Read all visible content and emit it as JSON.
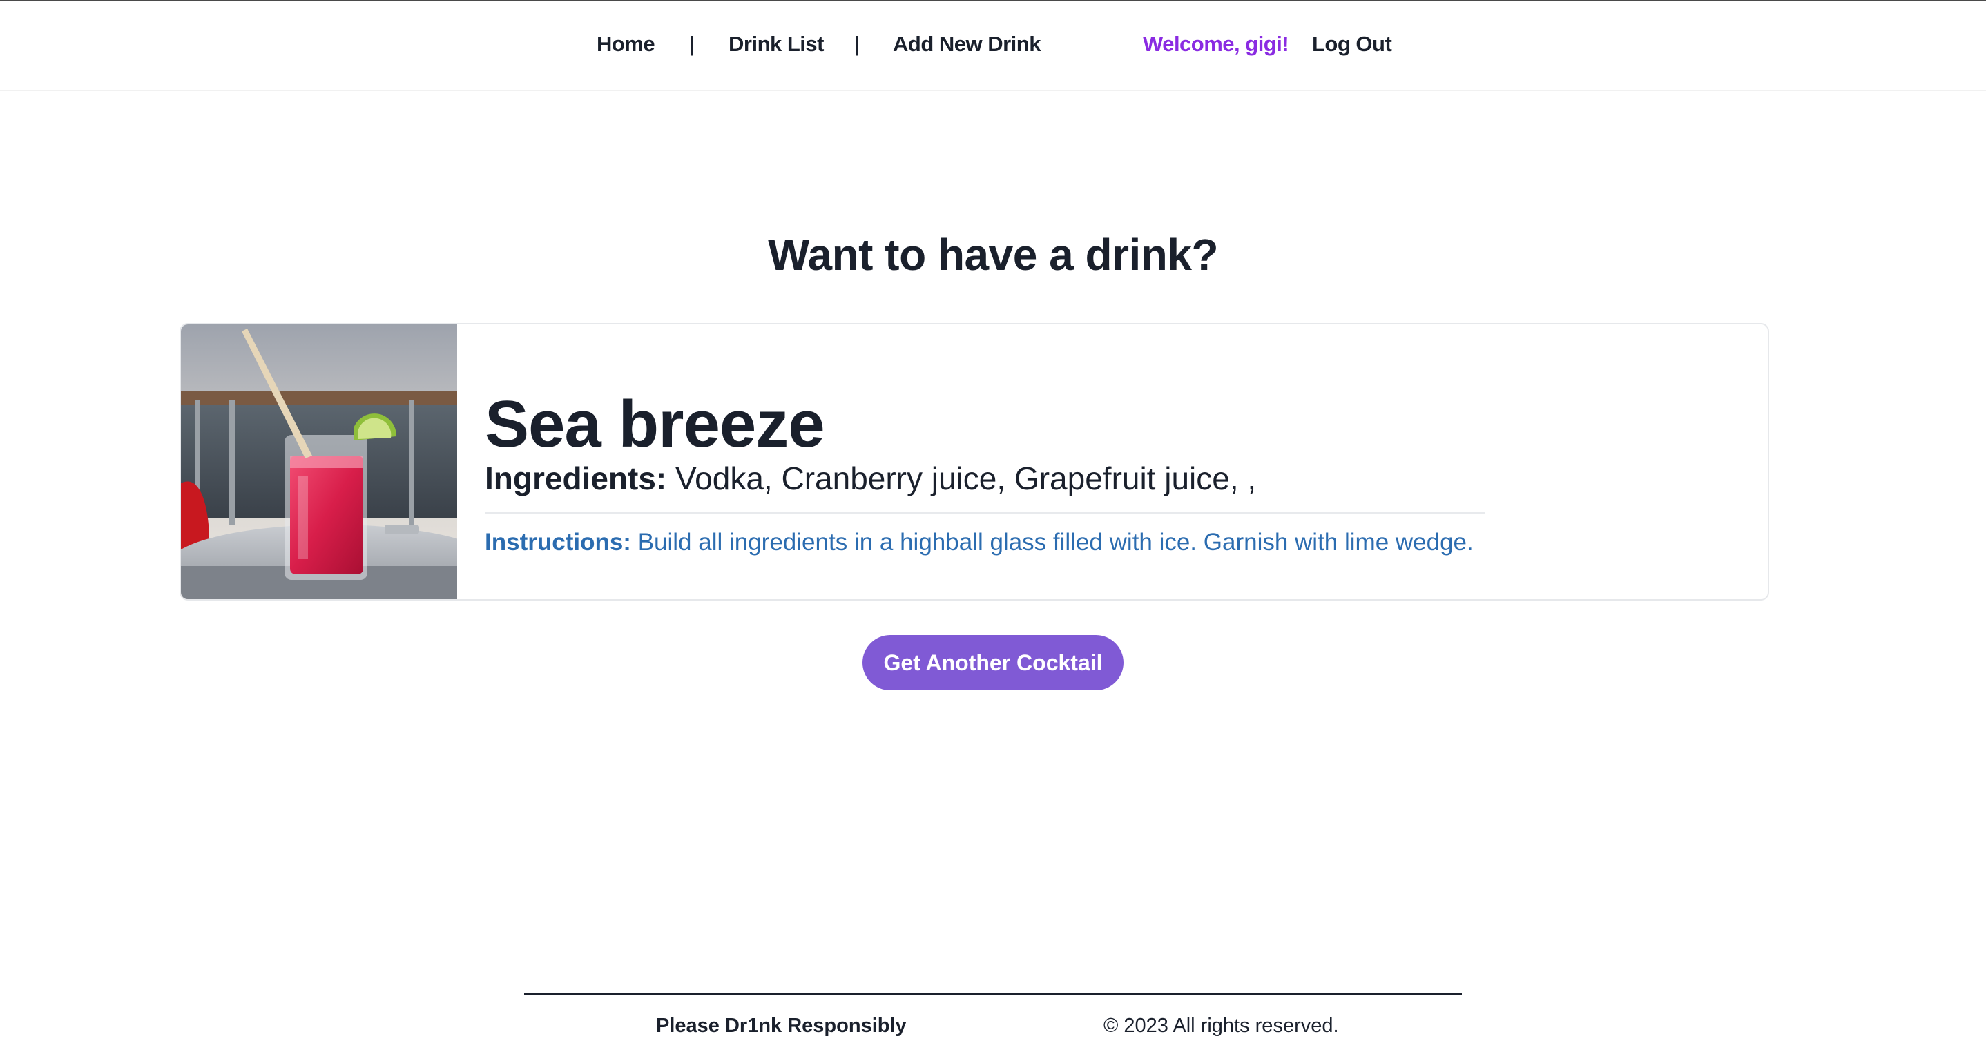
{
  "nav": {
    "home_label": "Home",
    "separator": "|",
    "drink_list_label": "Drink List",
    "add_new_label": "Add New Drink",
    "welcome_text": "Welcome, gigi!",
    "logout_label": "Log Out"
  },
  "main": {
    "heading": "Want to have a drink?",
    "drink": {
      "name": "Sea breeze",
      "ingredients_label": "Ingredients:",
      "ingredients": "Vodka, Cranberry juice, Grapefruit juice, ,",
      "instructions_label": "Instructions:",
      "instructions": "Build all ingredients in a highball glass filled with ice. Garnish with lime wedge."
    },
    "cta_label": "Get Another Cocktail"
  },
  "footer": {
    "tagline": "Please Dr1nk Responsibly",
    "copyright": "© 2023 All rights reserved."
  },
  "colors": {
    "welcome": "#8a2be2",
    "button": "#805ad5",
    "instructions": "#2b6cb0",
    "text": "#1a202c"
  }
}
